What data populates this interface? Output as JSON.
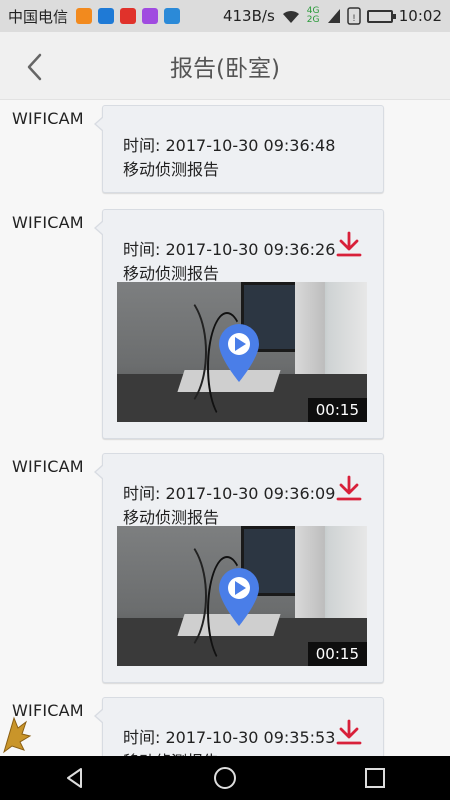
{
  "status_bar": {
    "carrier": "中国电信",
    "net_speed": "413B/s",
    "network_label": "4G 2G",
    "time": "10:02",
    "app_icon_colors": [
      "#f28a1e",
      "#1f7ad6",
      "#e0322b",
      "#a04be0",
      "#2b8ad8"
    ]
  },
  "header": {
    "title": "报告(卧室)",
    "back_icon": "chevron-left-icon"
  },
  "reports": [
    {
      "sender": "WIFICAM",
      "time_label": "时间: 2017-10-30 09:36:48",
      "type": "移动侦测报告",
      "has_video": false,
      "duration": ""
    },
    {
      "sender": "WIFICAM",
      "time_label": "时间: 2017-10-30 09:36:26",
      "type": "移动侦测报告",
      "has_video": true,
      "duration": "00:15"
    },
    {
      "sender": "WIFICAM",
      "time_label": "时间: 2017-10-30 09:36:09",
      "type": "移动侦测报告",
      "has_video": true,
      "duration": "00:15"
    },
    {
      "sender": "WIFICAM",
      "time_label": "时间: 2017-10-30 09:35:53",
      "type": "移动侦测报告",
      "has_video": true,
      "duration": ""
    }
  ],
  "colors": {
    "download_red": "#d8203a",
    "play_blue": "#4a7ee8"
  },
  "nav_bar": {
    "back_icon": "triangle-back-icon",
    "home_icon": "circle-home-icon",
    "recents_icon": "square-recents-icon"
  }
}
